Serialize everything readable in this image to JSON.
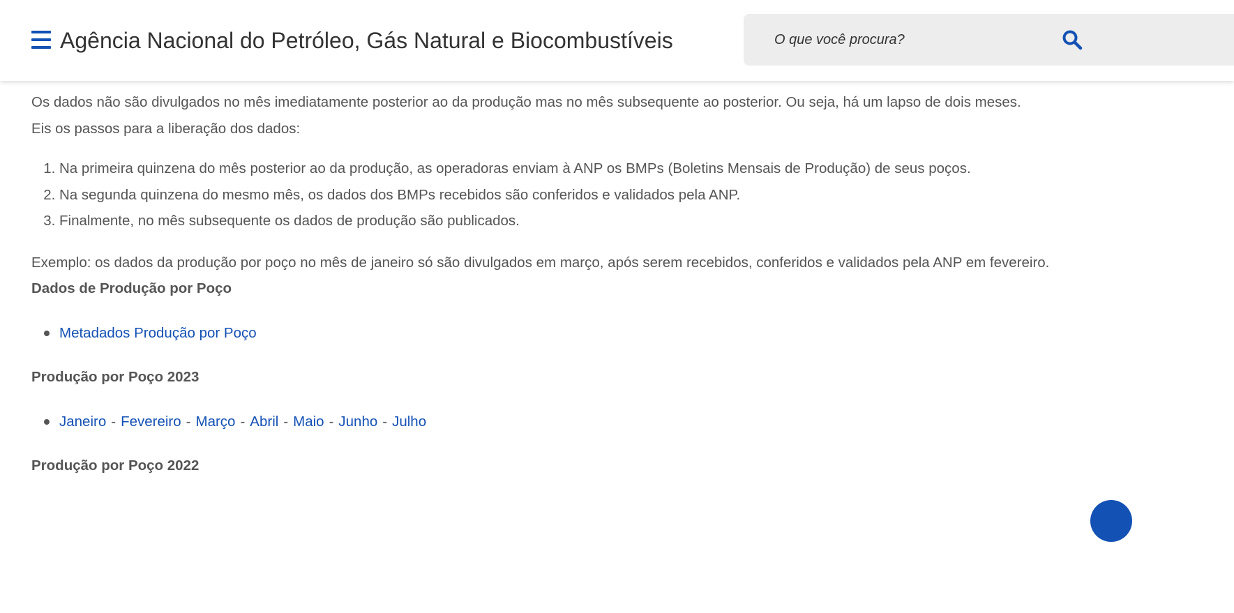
{
  "header": {
    "menu_icon": "hamburger-menu-icon",
    "title": "Agência Nacional do Petróleo, Gás Natural e Biocombustíveis",
    "search": {
      "placeholder": "O que você procura?",
      "value": "",
      "icon": "search-icon"
    }
  },
  "content": {
    "intro_line1": "Os dados não são divulgados no mês imediatamente posterior ao da produção mas no mês subsequente ao posterior. Ou seja, há um lapso de dois meses.",
    "intro_line2": "Eis os passos para a liberação dos dados:",
    "steps": [
      "Na primeira quinzena do mês posterior ao da produção, as operadoras enviam à ANP os BMPs (Boletins Mensais de Produção) de seus poços.",
      "Na segunda quinzena do mesmo mês, os dados dos BMPs recebidos são conferidos e validados pela ANP.",
      "Finalmente, no mês subsequente os dados de produção são publicados."
    ],
    "example": "Exemplo: os dados da produção por poço no mês de janeiro só são divulgados em março, após serem recebidos, conferidos e validados pela ANP em fevereiro.",
    "section_dados": {
      "title": "Dados de Produção por Poço",
      "link": "Metadados Produção por Poço"
    },
    "section_2023": {
      "title": "Produção por Poço 2023",
      "separator": "-",
      "months": [
        "Janeiro",
        "Fevereiro",
        "Março",
        "Abril",
        "Maio",
        "Junho",
        "Julho"
      ]
    },
    "section_2022": {
      "title": "Produção por Poço 2022"
    }
  },
  "colors": {
    "accent": "#1351b4",
    "text": "#555555",
    "title": "#333333",
    "search_bg": "#ededed"
  }
}
